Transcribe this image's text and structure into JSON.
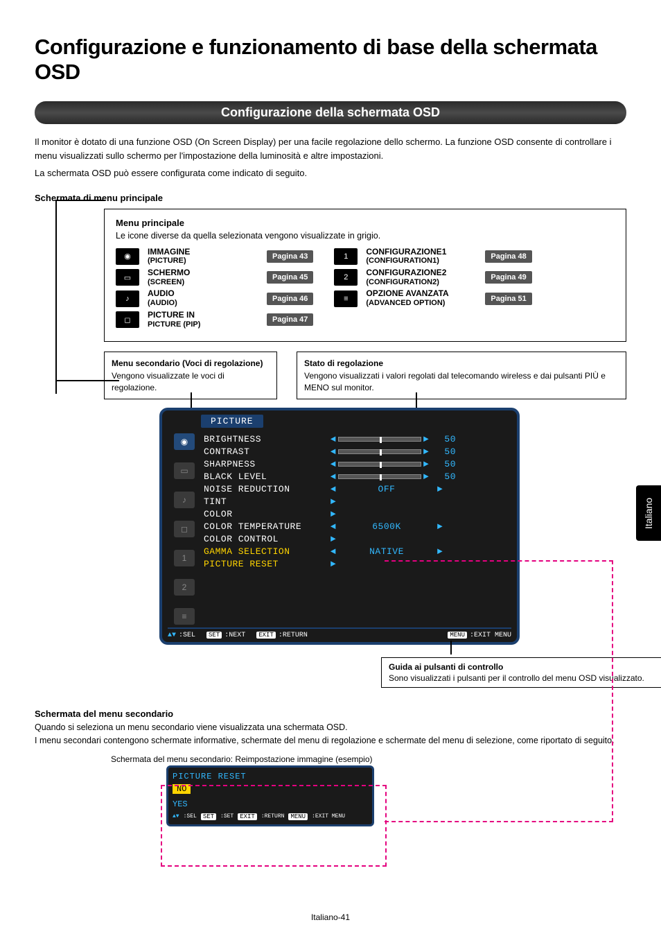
{
  "page": {
    "title": "Configurazione e funzionamento di base della schermata OSD",
    "section_title": "Configurazione della schermata OSD",
    "intro_p1": "Il monitor è dotato di una funzione OSD (On Screen Display) per una facile regolazione dello schermo. La funzione OSD consente di controllare i menu visualizzati sullo schermo per l'impostazione della luminosità e altre impostazioni.",
    "intro_p2": "La schermata OSD può essere configurata come indicato di seguito.",
    "main_menu_screen_label": "Schermata di menu principale",
    "footer": "Italiano-41",
    "side_tab": "Italiano"
  },
  "main_box": {
    "title": "Menu principale",
    "note": "Le icone diverse da quella selezionata vengono visualizzate in grigio.",
    "items_left": [
      {
        "label": "IMMAGINE",
        "sub": "(PICTURE)",
        "page": "Pagina 43"
      },
      {
        "label": "SCHERMO",
        "sub": "(SCREEN)",
        "page": "Pagina 45"
      },
      {
        "label": "AUDIO",
        "sub": "(AUDIO)",
        "page": "Pagina 46"
      },
      {
        "label": "PICTURE IN",
        "sub": "PICTURE (PIP)",
        "page": "Pagina 47"
      }
    ],
    "items_right": [
      {
        "label": "CONFIGURAZIONE1",
        "sub": "(CONFIGURATION1)",
        "page": "Pagina 48"
      },
      {
        "label": "CONFIGURAZIONE2",
        "sub": "(CONFIGURATION2)",
        "page": "Pagina 49"
      },
      {
        "label": "OPZIONE AVANZATA",
        "sub": "(ADVANCED OPTION)",
        "page": "Pagina 51"
      }
    ]
  },
  "sub_menu_box": {
    "title": "Menu secondario (Voci di regolazione)",
    "text": "Vengono visualizzate le voci di regolazione."
  },
  "status_box": {
    "title": "Stato di regolazione",
    "text": "Vengono visualizzati i valori regolati dal telecomando wireless e dai pulsanti PIÙ e MENO sul monitor."
  },
  "osd": {
    "title": "PICTURE",
    "rows": [
      {
        "label": "BRIGHTNESS",
        "val": "50",
        "type": "slider"
      },
      {
        "label": "CONTRAST",
        "val": "50",
        "type": "slider"
      },
      {
        "label": "SHARPNESS",
        "val": "50",
        "type": "slider"
      },
      {
        "label": "BLACK LEVEL",
        "val": "50",
        "type": "slider"
      },
      {
        "label": "NOISE REDUCTION",
        "center": "OFF",
        "type": "center"
      },
      {
        "label": "TINT",
        "type": "nav"
      },
      {
        "label": "COLOR",
        "type": "nav"
      },
      {
        "label": "COLOR TEMPERATURE",
        "center": "6500K",
        "type": "center"
      },
      {
        "label": "COLOR CONTROL",
        "type": "nav"
      },
      {
        "label": "GAMMA SELECTION",
        "center": "NATIVE",
        "type": "center",
        "sel": true
      },
      {
        "label": "PICTURE RESET",
        "type": "nav",
        "sel": true
      }
    ],
    "footer": {
      "sel": ":SEL",
      "set": "SET",
      "next": ":NEXT",
      "exit": "EXIT",
      "return": ":RETURN",
      "menu": "MENU",
      "exitmenu": ":EXIT MENU"
    }
  },
  "guide_box": {
    "title": "Guida ai pulsanti di controllo",
    "text": "Sono visualizzati i pulsanti per il controllo del menu OSD visualizzato."
  },
  "secondary": {
    "header": "Schermata del menu secondario",
    "p1": "Quando si seleziona un menu secondario viene visualizzata una schermata OSD.",
    "p2": "I menu secondari contengono schermate informative, schermate del menu di regolazione e schermate del menu di selezione, come riportato di seguito.",
    "caption": "Schermata del menu secondario: Reimpostazione immagine (esempio)"
  },
  "sub_osd": {
    "title": "PICTURE RESET",
    "no": "NO",
    "yes": "YES",
    "footer": {
      "sel": ":SEL",
      "set": "SET",
      "setlbl": ":SET",
      "exit": "EXIT",
      "return": ":RETURN",
      "menu": "MENU",
      "exitmenu": ":EXIT MENU"
    }
  }
}
